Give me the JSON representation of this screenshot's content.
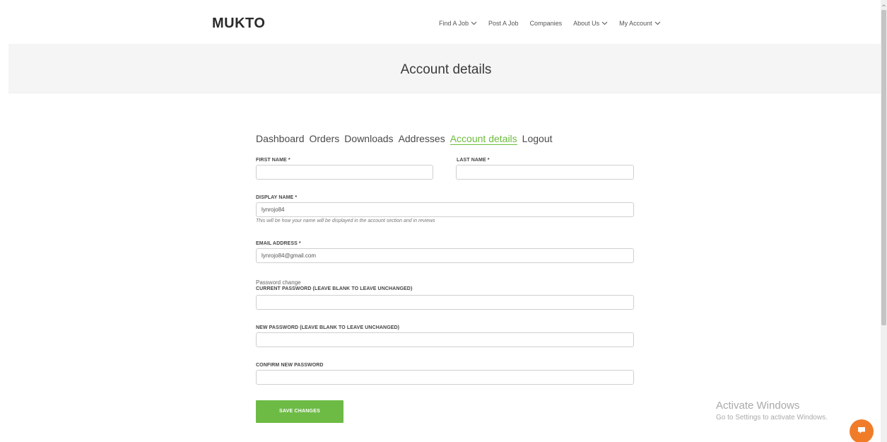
{
  "header": {
    "logo": "MUKTO",
    "nav": [
      {
        "label": "Find A Job",
        "dropdown": true
      },
      {
        "label": "Post A Job",
        "dropdown": false
      },
      {
        "label": "Companies",
        "dropdown": false
      },
      {
        "label": "About Us",
        "dropdown": true
      },
      {
        "label": "My Account",
        "dropdown": true
      }
    ]
  },
  "banner": {
    "title": "Account details"
  },
  "tabs": [
    {
      "label": "Dashboard",
      "active": false
    },
    {
      "label": "Orders",
      "active": false
    },
    {
      "label": "Downloads",
      "active": false
    },
    {
      "label": "Addresses",
      "active": false
    },
    {
      "label": "Account details",
      "active": true
    },
    {
      "label": "Logout",
      "active": false
    }
  ],
  "form": {
    "first_name_label": "FIRST NAME *",
    "first_name_value": "",
    "last_name_label": "LAST NAME *",
    "last_name_value": "",
    "display_name_label": "DISPLAY NAME *",
    "display_name_value": "lynrojo84",
    "display_name_hint": "This will be how your name will be displayed in the account section and in reviews",
    "email_label": "EMAIL ADDRESS *",
    "email_value": "lynrojo84@gmail.com",
    "password_legend": "Password change",
    "current_password_label": "CURRENT PASSWORD (LEAVE BLANK TO LEAVE UNCHANGED)",
    "current_password_value": "",
    "new_password_label": "NEW PASSWORD (LEAVE BLANK TO LEAVE UNCHANGED)",
    "new_password_value": "",
    "confirm_password_label": "CONFIRM NEW PASSWORD",
    "confirm_password_value": "",
    "save_label": "SAVE CHANGES"
  },
  "watermark": {
    "title": "Activate Windows",
    "subtitle": "Go to Settings to activate Windows."
  },
  "colors": {
    "accent_green": "#6dbb45",
    "chat_orange": "#f07c2a"
  },
  "icons": {
    "nav_dropdown": "chevron-down-icon",
    "chat": "chat-icon"
  }
}
